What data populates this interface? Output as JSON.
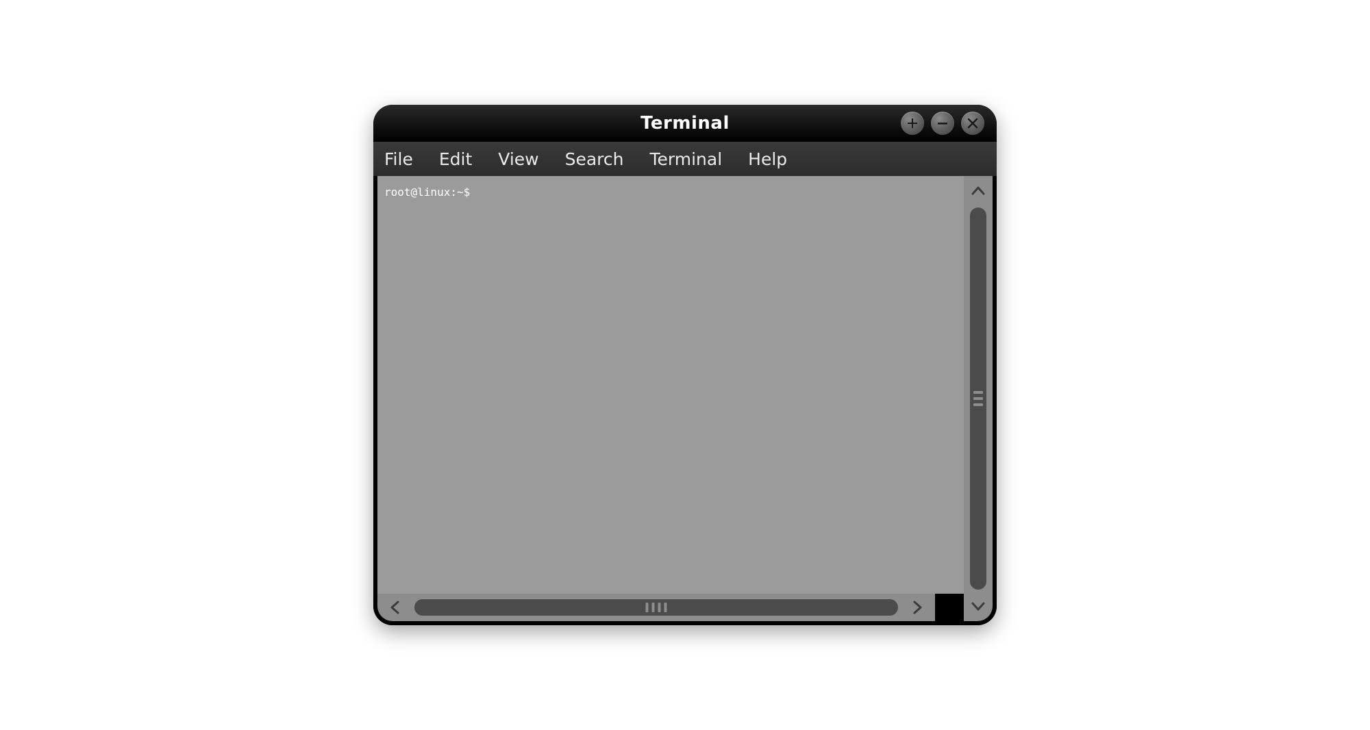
{
  "window": {
    "title": "Terminal"
  },
  "menubar": {
    "items": [
      {
        "label": "File"
      },
      {
        "label": "Edit"
      },
      {
        "label": "View"
      },
      {
        "label": "Search"
      },
      {
        "label": "Terminal"
      },
      {
        "label": "Help"
      }
    ]
  },
  "terminal": {
    "prompt": "root@linux:~$"
  }
}
